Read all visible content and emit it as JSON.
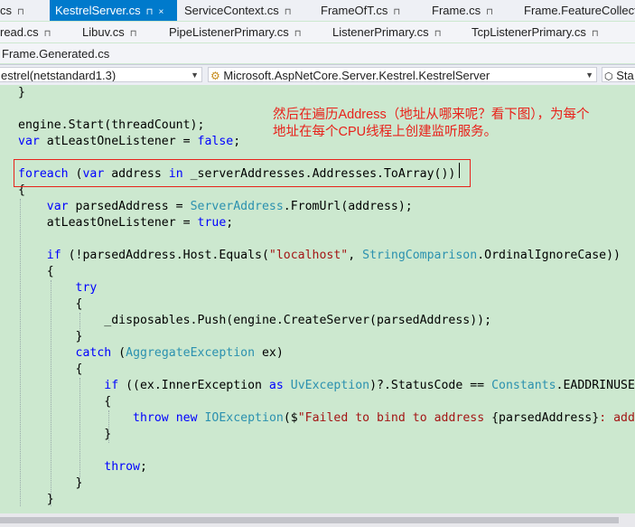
{
  "tabs_row1": [
    {
      "label": "cs",
      "active": false
    },
    {
      "label": "KestrelServer.cs",
      "active": true
    },
    {
      "label": "ServiceContext.cs",
      "active": false
    },
    {
      "label": "FrameOfT.cs",
      "active": false
    },
    {
      "label": "Frame.cs",
      "active": false
    },
    {
      "label": "Frame.FeatureCollecti",
      "active": false
    }
  ],
  "tabs_row2": [
    {
      "label": "read.cs"
    },
    {
      "label": "Libuv.cs"
    },
    {
      "label": "PipeListenerPrimary.cs"
    },
    {
      "label": "ListenerPrimary.cs"
    },
    {
      "label": "TcpListenerPrimary.cs"
    }
  ],
  "tabs_row3": [
    {
      "label": "Frame.Generated.cs"
    }
  ],
  "navbar": {
    "project": "estrel(netstandard1.3)",
    "type": "Microsoft.AspNetCore.Server.Kestrel.KestrelServer",
    "member": "Sta"
  },
  "annotation": {
    "line1": "然后在遍历Address（地址从哪来呢？看下图），为每个",
    "line2": "地址在每个CPU线程上创建监听服务。"
  },
  "code": {
    "l01": "}",
    "l03a": "engine.Start(threadCount);",
    "l04a": "var",
    "l04b": " atLeastOneListener = ",
    "l04c": "false",
    "l04d": ";",
    "l06a": "foreach",
    "l06b": " (",
    "l06c": "var",
    "l06d": " address ",
    "l06e": "in",
    "l06f": " _serverAddresses.Addresses.ToArray())",
    "l07": "{",
    "l08a": "var",
    "l08b": " parsedAddress = ",
    "l08c": "ServerAddress",
    "l08d": ".FromUrl(address);",
    "l09a": "atLeastOneListener = ",
    "l09b": "true",
    "l09c": ";",
    "l11a": "if",
    "l11b": " (!parsedAddress.Host.Equals(",
    "l11c": "\"localhost\"",
    "l11d": ", ",
    "l11e": "StringComparison",
    "l11f": ".OrdinalIgnoreCase))",
    "l12": "{",
    "l13": "try",
    "l14": "{",
    "l15": "_disposables.Push(engine.CreateServer(parsedAddress));",
    "l16": "}",
    "l17a": "catch",
    "l17b": " (",
    "l17c": "AggregateException",
    "l17d": " ex)",
    "l18": "{",
    "l19a": "if",
    "l19b": " ((ex.InnerException ",
    "l19c": "as",
    "l19d": " ",
    "l19e": "UvException",
    "l19f": ")?.StatusCode == ",
    "l19g": "Constants",
    "l19h": ".EADDRINUSE",
    "l20": "{",
    "l21a": "throw",
    "l21b": " ",
    "l21c": "new",
    "l21d": " ",
    "l21e": "IOException",
    "l21f": "($",
    "l21g": "\"Failed to bind to address ",
    "l21h": "{parsedAddress}",
    "l21i": ": add",
    "l22": "}",
    "l24a": "throw",
    "l24b": ";",
    "l25": "}",
    "l26": "}"
  },
  "colors": {
    "keyword": "#0000ff",
    "type": "#2b91af",
    "string": "#a31515",
    "editor_bg": "#cce8cf",
    "annotation": "#e8221b",
    "active_tab": "#007acc"
  }
}
